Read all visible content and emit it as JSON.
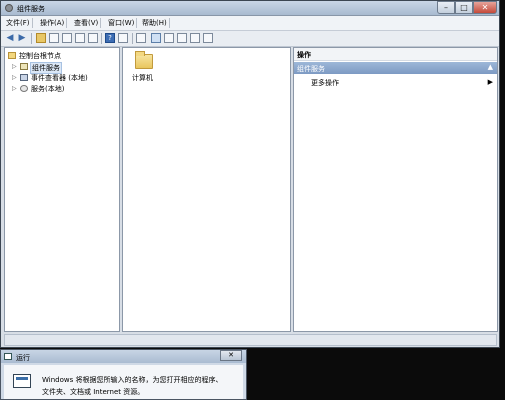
{
  "window": {
    "title": "组件服务",
    "caption_minimize": "–",
    "caption_maximize": "□",
    "caption_close": "✕"
  },
  "menubar": {
    "items": [
      "文件(F)",
      "操作(A)",
      "查看(V)",
      "窗口(W)",
      "帮助(H)"
    ]
  },
  "toolbar": {
    "icons": [
      "back-arrow-icon",
      "forward-arrow-icon",
      "up-folder-icon",
      "show-hide-tree-icon",
      "properties-icon",
      "refresh-icon",
      "export-icon",
      "help-icon",
      "console-icon",
      "large-icons-icon",
      "small-icons-icon",
      "list-view-icon",
      "details-view-icon",
      "grid-view-icon"
    ]
  },
  "tree": {
    "root": "控制台根节点",
    "items": [
      {
        "label": "组件服务",
        "icon": "component-services-icon",
        "selected": true
      },
      {
        "label": "事件查看器 (本地)",
        "icon": "event-viewer-icon",
        "selected": false
      },
      {
        "label": "服务(本地)",
        "icon": "services-icon",
        "selected": false
      }
    ]
  },
  "list": {
    "items": [
      {
        "label": "计算机",
        "icon": "folder-icon"
      }
    ]
  },
  "actions": {
    "header": "操作",
    "section": "组件服务",
    "section_caret": "▲",
    "more": "更多操作",
    "more_caret": "▶"
  },
  "run_dialog": {
    "title": "运行",
    "close": "✕",
    "line1": "Windows 将根据您所输入的名称，为您打开相应的程序、",
    "line2": "文件夹、文档或 Internet 资源。"
  },
  "colors": {
    "titlebar": "#b7c7da",
    "selection": "#dbe7f6",
    "action_section": "#8ea9cf",
    "desktop": "#0b0b0b"
  }
}
